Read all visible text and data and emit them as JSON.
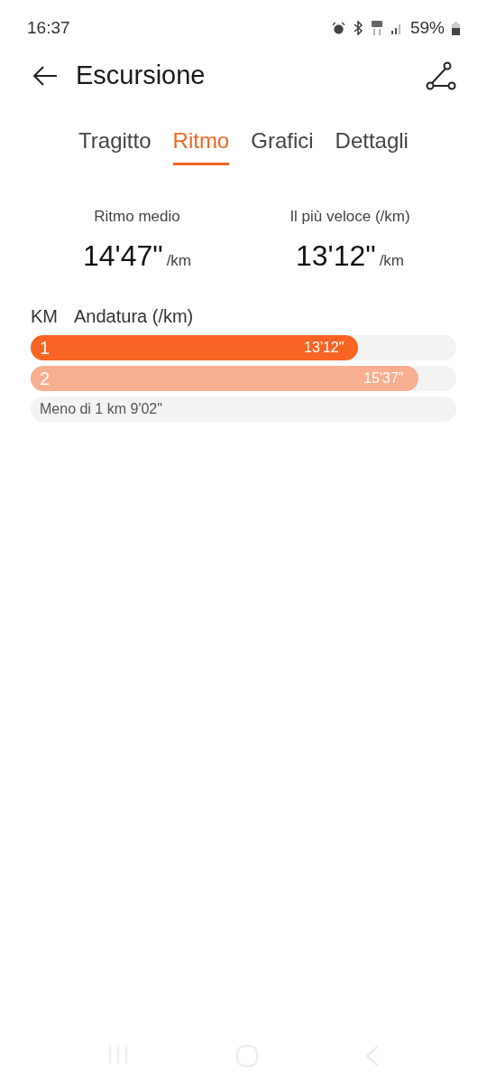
{
  "status_bar": {
    "time": "16:37",
    "battery": "59%"
  },
  "header": {
    "title": "Escursione"
  },
  "tabs": [
    {
      "label": "Tragitto",
      "selected": false
    },
    {
      "label": "Ritmo",
      "selected": true
    },
    {
      "label": "Grafici",
      "selected": false
    },
    {
      "label": "Dettagli",
      "selected": false
    }
  ],
  "stats": [
    {
      "label": "Ritmo medio",
      "value": "14'47\"",
      "unit": "/km"
    },
    {
      "label": "Il più veloce (/km)",
      "value": "13'12\"",
      "unit": "/km"
    }
  ],
  "splits": {
    "columns": [
      "KM",
      "Andatura (/km)"
    ],
    "rows": [
      {
        "kind": "bar",
        "km": "1",
        "pace": "13'12\"",
        "level": 0.77,
        "color": "#f86424"
      },
      {
        "kind": "bar",
        "km": "2",
        "pace": "15'37\"",
        "level": 0.91,
        "color": "#f8ae90"
      },
      {
        "kind": "text",
        "text": "Meno di 1 km 9'02\""
      }
    ]
  }
}
